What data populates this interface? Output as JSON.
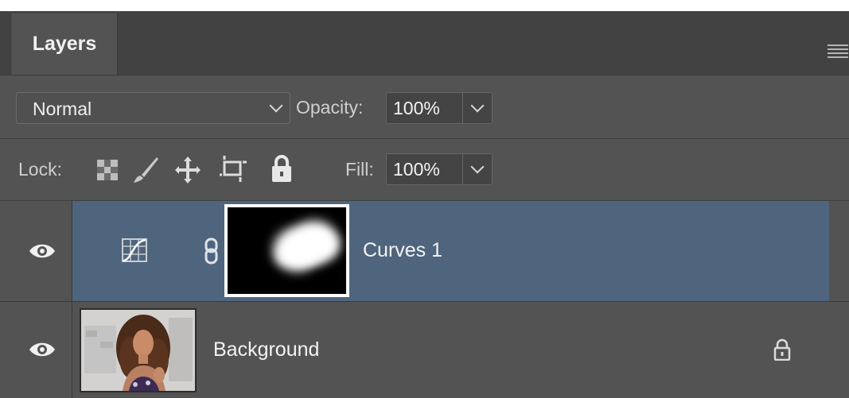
{
  "panel": {
    "tab_label": "Layers",
    "menu_icon": "hamburger-menu-icon"
  },
  "blend": {
    "mode": "Normal",
    "opacity_label": "Opacity:",
    "opacity_value": "100%"
  },
  "lock": {
    "label": "Lock:",
    "fill_label": "Fill:",
    "fill_value": "100%"
  },
  "layers": [
    {
      "name": "Curves 1",
      "visible": true,
      "selected": true,
      "type": "curves-adjustment",
      "has_mask": true,
      "linked_mask": true
    },
    {
      "name": "Background",
      "visible": true,
      "selected": false,
      "type": "image",
      "locked": true
    }
  ],
  "colors": {
    "panel_bg": "#535353",
    "selected_row": "#4f657d",
    "tab_bar": "#424242"
  }
}
